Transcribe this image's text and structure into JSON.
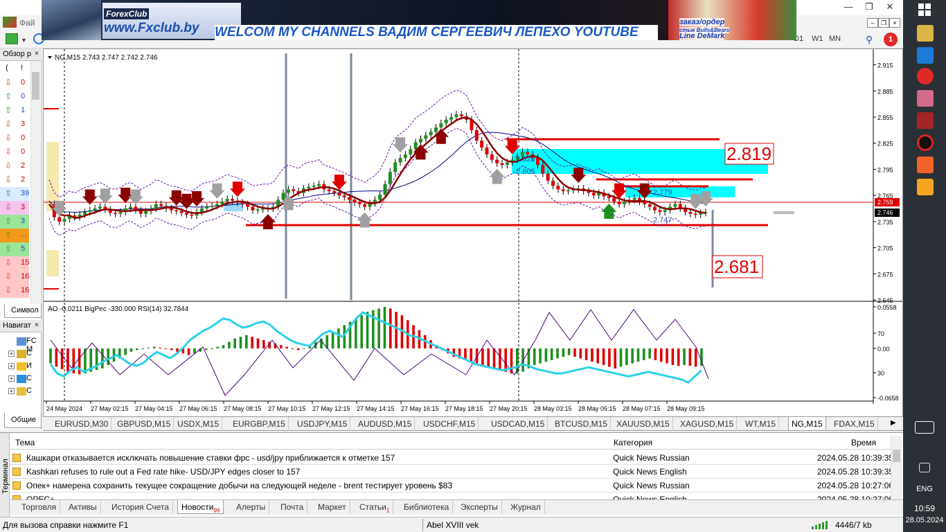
{
  "app": {
    "menu_first": "Фай",
    "timeframes": [
      "D1",
      "W1",
      "MN"
    ]
  },
  "banner": {
    "brand": "ForexClub",
    "site": "www.Fxclub.by",
    "headline": "WELCOM MY CHANNELS ВАДИМ СЕРГЕЕВИЧ ЛЕПЕХО YOUTUBE",
    "flag_label_1": "заказ/ордер",
    "flag_label_2": "стык Bulls&Bears",
    "flag_label_3": "Line DeMark"
  },
  "market_watch": {
    "title": "Обзор р",
    "col_1": "(",
    "col_2": "!",
    "tab": "Символ",
    "rows": [
      {
        "val": "0",
        "dir": "down",
        "bg": "#ffffff"
      },
      {
        "val": "0",
        "dir": "up",
        "bg": "#ffffff"
      },
      {
        "val": "1",
        "dir": "up",
        "bg": "#ffffff"
      },
      {
        "val": "3",
        "dir": "down",
        "bg": "#ffffff"
      },
      {
        "val": "0",
        "dir": "down",
        "bg": "#ffffff"
      },
      {
        "val": "0",
        "dir": "down",
        "bg": "#ffffff"
      },
      {
        "val": "2",
        "dir": "down",
        "bg": "#ffffff"
      },
      {
        "val": "2",
        "dir": "down",
        "bg": "#ffffff"
      },
      {
        "val": "39",
        "dir": "up",
        "bg": "#d7ecff"
      },
      {
        "val": "3",
        "dir": "down",
        "bg": "#f4c4ef"
      },
      {
        "val": "3",
        "dir": "up",
        "bg": "#9be59b"
      },
      {
        "val": "...",
        "dir": "up",
        "bg": "#f39a1a"
      },
      {
        "val": "5",
        "dir": "up",
        "bg": "#9be59b"
      },
      {
        "val": "15",
        "dir": "down",
        "bg": "#ffc7c7"
      },
      {
        "val": "16",
        "dir": "down",
        "bg": "#ffc7c7"
      },
      {
        "val": "16",
        "dir": "down",
        "bg": "#ffc7c7"
      }
    ]
  },
  "navigator": {
    "title": "Навигат",
    "tab": "Общие",
    "items": [
      {
        "label": "FC M",
        "expanded": false
      },
      {
        "label": "C",
        "expanded": true
      },
      {
        "label": "И",
        "expanded": true
      },
      {
        "label": "С",
        "expanded": true
      },
      {
        "label": "С",
        "expanded": true
      }
    ]
  },
  "chart": {
    "header": "NG,M15  2.743 2.747 2.742 2.746",
    "sub_header": "AO -0.0211  BigPec -330.000  RSI(14) 32.7844",
    "price_scale": [
      "2.915",
      "2.885",
      "2.855",
      "2.825",
      "2.795",
      "2.765",
      "2.735",
      "2.705",
      "2.675",
      "2.645"
    ],
    "price_tags": {
      "upper": "2.759",
      "current": "2.746"
    },
    "osc_scale": [
      "0.0558",
      "70",
      "0.00",
      "30",
      "-0.0658"
    ],
    "time_scale": [
      "24 May 2024",
      "27 May 02:15",
      "27 May 04:15",
      "27 May 06:15",
      "27 May 08:15",
      "27 May 10:15",
      "27 May 12:15",
      "27 May 14:15",
      "27 May 16:15",
      "27 May 18:15",
      "27 May 20:15",
      "28 May 03:15",
      "28 May 05:15",
      "28 May 07:15",
      "28 May 09:15"
    ],
    "labels": {
      "box_high": "2.819",
      "box_low": "2.681",
      "lvl_1": "2.820",
      "lvl_2": "2.805",
      "lvl_3": "2.779",
      "lvl_4": "2.747"
    },
    "colors": {
      "bull": "#1e8f1e",
      "bear": "#e00000",
      "bear_dark": "#8b0000",
      "cyan": "#00ffff",
      "ma_fast": "#8b0000",
      "ma_slow": "#00008b",
      "envelope": "#6a0dad",
      "rsi": "#2ad1e8",
      "osc": "#4b0082"
    },
    "close_series": [
      2.755,
      2.74,
      2.735,
      2.738,
      2.742,
      2.74,
      2.743,
      2.746,
      2.748,
      2.75,
      2.752,
      2.749,
      2.745,
      2.744,
      2.746,
      2.75,
      2.752,
      2.748,
      2.744,
      2.747,
      2.75,
      2.755,
      2.753,
      2.75,
      2.748,
      2.747,
      2.745,
      2.743,
      2.742,
      2.746,
      2.75,
      2.752,
      2.753,
      2.755,
      2.758,
      2.761,
      2.759,
      2.757,
      2.755,
      2.752,
      2.748,
      2.749,
      2.75,
      2.75,
      2.752,
      2.76,
      2.768,
      2.772,
      2.77,
      2.768,
      2.773,
      2.775,
      2.776,
      2.778,
      2.772,
      2.77,
      2.768,
      2.765,
      2.763,
      2.76,
      2.757,
      2.755,
      2.752,
      2.756,
      2.76,
      2.766,
      2.778,
      2.792,
      2.803,
      2.808,
      2.812,
      2.818,
      2.826,
      2.83,
      2.834,
      2.838,
      2.843,
      2.848,
      2.852,
      2.855,
      2.858,
      2.856,
      2.852,
      2.84,
      2.828,
      2.82,
      2.812,
      2.806,
      2.802,
      2.8,
      2.803,
      2.806,
      2.81,
      2.815,
      2.812,
      2.808,
      2.8,
      2.79,
      2.782,
      2.776,
      2.772,
      2.77,
      2.771,
      2.772,
      2.773,
      2.77,
      2.768,
      2.765,
      2.768,
      2.764,
      2.762,
      2.758,
      2.755,
      2.758,
      2.76,
      2.762,
      2.758,
      2.755,
      2.752,
      2.748,
      2.746,
      2.748,
      2.752,
      2.755,
      2.75,
      2.746,
      2.744,
      2.743,
      2.745,
      2.746
    ],
    "ao_series": [
      -0.018,
      -0.022,
      -0.025,
      -0.028,
      -0.03,
      -0.031,
      -0.03,
      -0.028,
      -0.026,
      -0.024,
      -0.02,
      -0.016,
      -0.012,
      -0.008,
      -0.004,
      -0.002,
      0.0,
      0.001,
      0.002,
      0.001,
      0.0,
      -0.002,
      -0.004,
      -0.006,
      -0.008,
      -0.006,
      -0.004,
      -0.002,
      0.0,
      0.002,
      0.004,
      0.008,
      0.012,
      0.014,
      0.016,
      0.014,
      0.012,
      0.01,
      0.008,
      0.006,
      0.004,
      0.002,
      0.0,
      -0.002,
      0.0,
      0.004,
      0.008,
      0.012,
      0.016,
      0.02,
      0.024,
      0.028,
      0.032,
      0.036,
      0.04,
      0.044,
      0.046,
      0.048,
      0.05,
      0.048,
      0.044,
      0.04,
      0.034,
      0.028,
      0.022,
      0.016,
      0.01,
      0.004,
      -0.002,
      -0.006,
      -0.01,
      -0.012,
      -0.014,
      -0.016,
      -0.018,
      -0.02,
      -0.022,
      -0.024,
      -0.026,
      -0.028,
      -0.03,
      -0.03,
      -0.028,
      -0.024,
      -0.02,
      -0.018,
      -0.016,
      -0.014,
      -0.012,
      -0.01,
      -0.008,
      -0.01,
      -0.012,
      -0.014,
      -0.016,
      -0.018,
      -0.02,
      -0.022,
      -0.024,
      -0.022,
      -0.02,
      -0.018,
      -0.016,
      -0.014,
      -0.012,
      -0.014,
      -0.016,
      -0.018,
      -0.02,
      -0.021,
      -0.02,
      -0.021,
      -0.022,
      -0.021
    ],
    "rsi_series": [
      36,
      30,
      28,
      32,
      34,
      31,
      33,
      35,
      38,
      40,
      42,
      39,
      36,
      35,
      37,
      41,
      44,
      42,
      40,
      43,
      47,
      52,
      55,
      58,
      60,
      63,
      66,
      65,
      62,
      60,
      61,
      63,
      64,
      62,
      58,
      55,
      52,
      50,
      49,
      48,
      52,
      56,
      58,
      56,
      54,
      60,
      66,
      70,
      68,
      66,
      64,
      62,
      60,
      58,
      55,
      54,
      52,
      50,
      48,
      46,
      44,
      42,
      40,
      38,
      36,
      35,
      34,
      33,
      32,
      33,
      34,
      36,
      35,
      33,
      32,
      31,
      30,
      30,
      31,
      32,
      33,
      34,
      33,
      32,
      31,
      30,
      29,
      28,
      29,
      30,
      31,
      30,
      29,
      28,
      27,
      26,
      24,
      28,
      32
    ]
  },
  "chart_tabs": [
    {
      "label": "EURUSD,M30",
      "active": false
    },
    {
      "label": "GBPUSD,M15",
      "active": false
    },
    {
      "label": "USDX,M15",
      "active": false
    },
    {
      "label": "EURGBP,M15",
      "active": false
    },
    {
      "label": "USDJPY,M15",
      "active": false
    },
    {
      "label": "AUDUSD,M15",
      "active": false
    },
    {
      "label": "USDCHF,M15",
      "active": false
    },
    {
      "label": "USDCAD,M15",
      "active": false
    },
    {
      "label": "BTCUSD,M15",
      "active": false
    },
    {
      "label": "XAUUSD,M15",
      "active": false
    },
    {
      "label": "XAGUSD,M15",
      "active": false
    },
    {
      "label": "WT,M15",
      "active": false
    },
    {
      "label": "NG,M15",
      "active": true
    },
    {
      "label": "FDAX,M15",
      "active": false
    }
  ],
  "terminal": {
    "vertical_label": "Терминал",
    "columns": {
      "topic": "Тема",
      "category": "Категория",
      "time": "Время"
    },
    "news": [
      {
        "topic": "Кашкари отказывается исключать повышение ставки фрс - usd/jpy приближается к отметке 157",
        "category": "Quick News Russian",
        "time": "2024.05.28 10:39:35"
      },
      {
        "topic": "Kashkari refuses to rule out a Fed rate hike- USD/JPY edges closer to 157",
        "category": "Quick News English",
        "time": "2024.05.28 10:39:35"
      },
      {
        "topic": "Опек+ намерена сохранить текущее сокращение добычи на следующей неделе - brent тестирует уровень $83",
        "category": "Quick News Russian",
        "time": "2024.05.28 10:27:06"
      },
      {
        "topic": "OPEC+ ...",
        "category": "Quick News English",
        "time": "2024.05.28 10:27:06"
      }
    ],
    "tabs": [
      {
        "label": "Торговля",
        "active": false,
        "badge": ""
      },
      {
        "label": "Активы",
        "active": false,
        "badge": ""
      },
      {
        "label": "История Счета",
        "active": false,
        "badge": ""
      },
      {
        "label": "Новости",
        "active": true,
        "badge": "99"
      },
      {
        "label": "Алерты",
        "active": false,
        "badge": ""
      },
      {
        "label": "Почта",
        "active": false,
        "badge": ""
      },
      {
        "label": "Маркет",
        "active": false,
        "badge": ""
      },
      {
        "label": "Статьи",
        "active": false,
        "badge": "1"
      },
      {
        "label": "Библиотека",
        "active": false,
        "badge": ""
      },
      {
        "label": "Эксперты",
        "active": false,
        "badge": ""
      },
      {
        "label": "Журнал",
        "active": false,
        "badge": ""
      }
    ]
  },
  "status": {
    "help": "Для вызова справки нажмите F1",
    "profile": "Abel XVIII vek",
    "connection": "4446/7 kb"
  },
  "taskbar": {
    "lang": "ENG",
    "time": "10:59",
    "date": "28.05.2024"
  }
}
